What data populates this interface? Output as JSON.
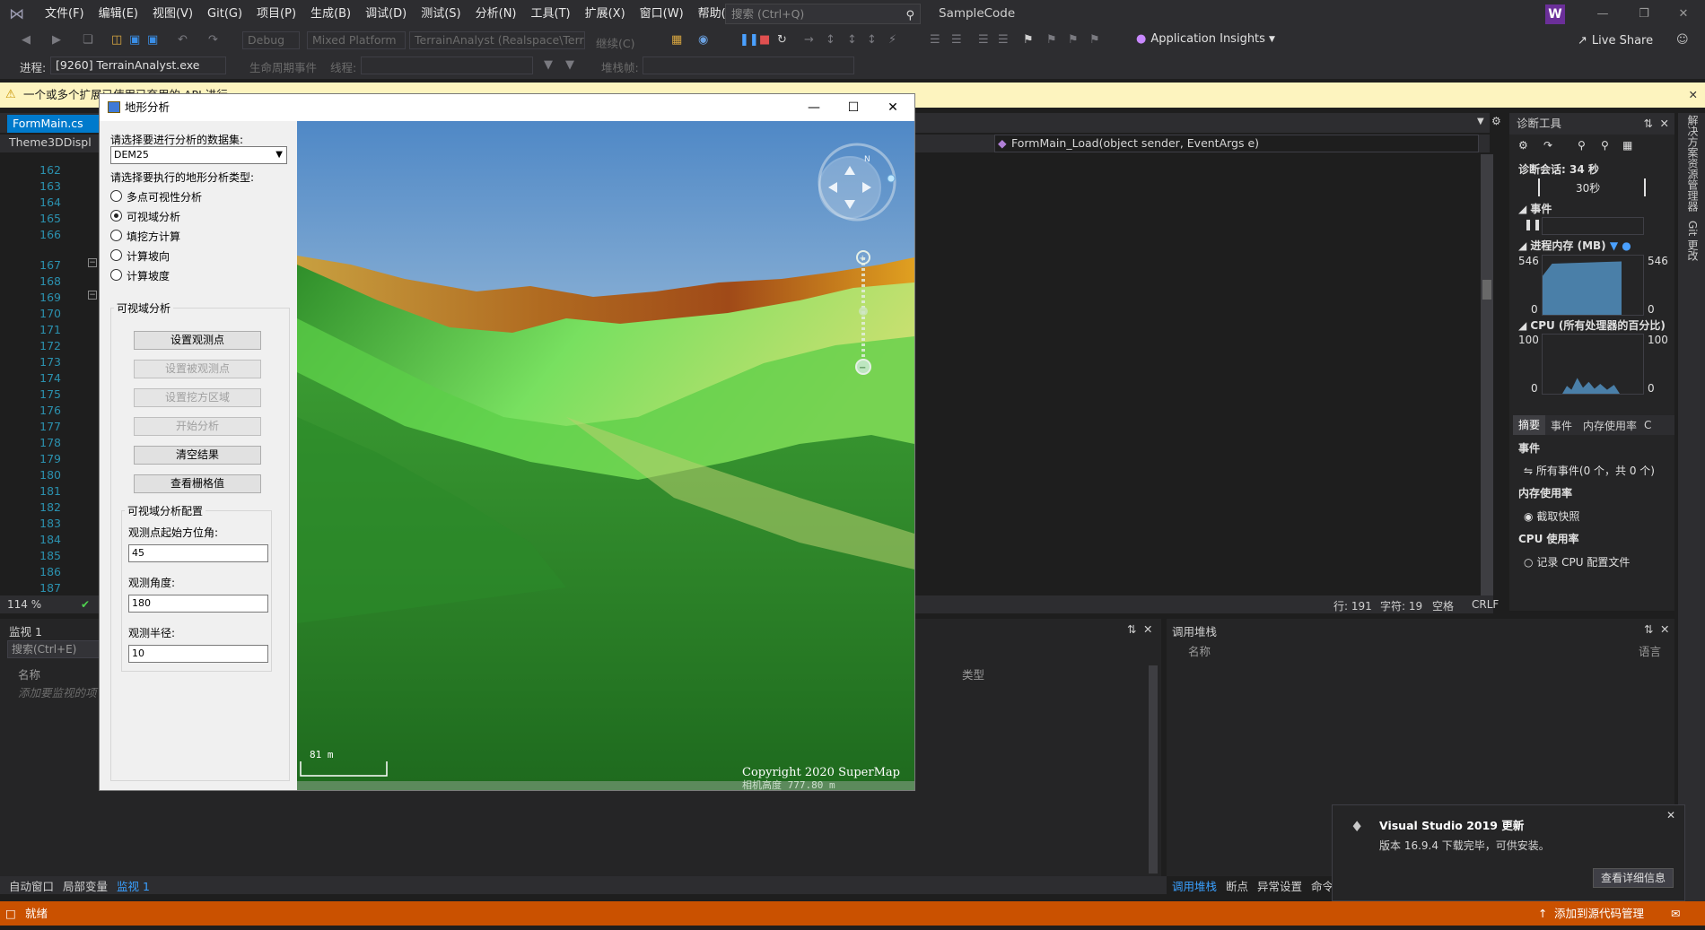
{
  "menu": {
    "items": [
      "文件(F)",
      "编辑(E)",
      "视图(V)",
      "Git(G)",
      "项目(P)",
      "生成(B)",
      "调试(D)",
      "测试(S)",
      "分析(N)",
      "工具(T)",
      "扩展(X)",
      "窗口(W)",
      "帮助(H)"
    ],
    "search_placeholder": "搜索 (Ctrl+Q)",
    "solution": "SampleCode",
    "avatar": "W"
  },
  "toolbar": {
    "config": "Debug",
    "platform": "Mixed Platform",
    "project": "TerrainAnalyst (Realspace\\Terra",
    "continue": "继续(C)",
    "app_insights": "Application Insights",
    "live_share": "Live Share"
  },
  "toolbar2": {
    "process_label": "进程:",
    "process": "[9260] TerrainAnalyst.exe",
    "lifecycle": "生命周期事件",
    "thread": "线程:",
    "stack": "堆栈帧:"
  },
  "infobar": {
    "text": "一个或多个扩展已使用已弃用的 API 进行..."
  },
  "editor": {
    "tab": "FormMain.cs",
    "nav_left": "Theme3DDispl",
    "nav_right": "FormMain_Load(object sender, EventArgs e)",
    "lines": [
      "162",
      "163",
      "164",
      "165",
      "166",
      "167",
      "168",
      "169",
      "170",
      "171",
      "172",
      "173",
      "174",
      "175",
      "176",
      "177",
      "178",
      "179",
      "180",
      "181",
      "182",
      "183",
      "184",
      "185",
      "186",
      "187"
    ],
    "zoom": "114 %",
    "row": "行: 191",
    "col": "字符: 19",
    "space": "空格",
    "crlf": "CRLF"
  },
  "diag": {
    "title": "诊断工具",
    "session": "诊断会话: 34 秒",
    "timeline": "30秒",
    "events": "事件",
    "memory": "进程内存 (MB)",
    "mem_max": "546",
    "mem_min": "0",
    "cpu": "CPU (所有处理器的百分比)",
    "cpu_max": "100",
    "cpu_min": "0",
    "tabs": [
      "摘要",
      "事件",
      "内存使用率",
      "C"
    ],
    "sec_events": "事件",
    "all_events": "所有事件(0 个，共 0 个)",
    "sec_mem": "内存使用率",
    "snapshot": "截取快照",
    "sec_cpu": "CPU 使用率",
    "record_cpu": "记录 CPU 配置文件"
  },
  "side": {
    "a": "解决方案资源管理器",
    "b": "Git 更改"
  },
  "watch": {
    "title": "监视 1",
    "search": "搜索(Ctrl+E)",
    "col_name": "名称",
    "col_type": "类型",
    "add_hint": "添加要监视的项"
  },
  "callstack": {
    "title": "调用堆栈",
    "col_name": "名称",
    "col_lang": "语言"
  },
  "bottomtabs": [
    "自动窗口",
    "局部变量",
    "监视 1"
  ],
  "bottomtabs2": [
    "调用堆栈",
    "断点",
    "异常设置",
    "命令"
  ],
  "status": {
    "ready": "就绪",
    "source": "添加到源代码管理"
  },
  "notif": {
    "title": "Visual Studio 2019 更新",
    "body": "版本 16.9.4 下载完毕，可供安装。",
    "button": "查看详细信息"
  },
  "form": {
    "title": "地形分析",
    "dataset_label": "请选择要进行分析的数据集:",
    "dataset": "DEM25",
    "type_label": "请选择要执行的地形分析类型:",
    "radios": [
      {
        "label": "多点可视性分析",
        "checked": false
      },
      {
        "label": "可视域分析",
        "checked": true
      },
      {
        "label": "填挖方计算",
        "checked": false
      },
      {
        "label": "计算坡向",
        "checked": false
      },
      {
        "label": "计算坡度",
        "checked": false
      }
    ],
    "group_title": "可视域分析",
    "buttons": [
      {
        "label": "设置观测点",
        "enabled": true
      },
      {
        "label": "设置被观测点",
        "enabled": false
      },
      {
        "label": "设置挖方区域",
        "enabled": false
      },
      {
        "label": "开始分析",
        "enabled": false
      },
      {
        "label": "清空结果",
        "enabled": true
      },
      {
        "label": "查看栅格值",
        "enabled": true
      }
    ],
    "config_title": "可视域分析配置",
    "azimuth_label": "观测点起始方位角:",
    "azimuth": "45",
    "angle_label": "观测角度:",
    "angle": "180",
    "radius_label": "观测半径:",
    "radius": "10",
    "scale": "81 m",
    "copyright": "Copyright 2020 SuperMap",
    "camera": "相机高度 777.80 m",
    "compass_n": "N"
  }
}
